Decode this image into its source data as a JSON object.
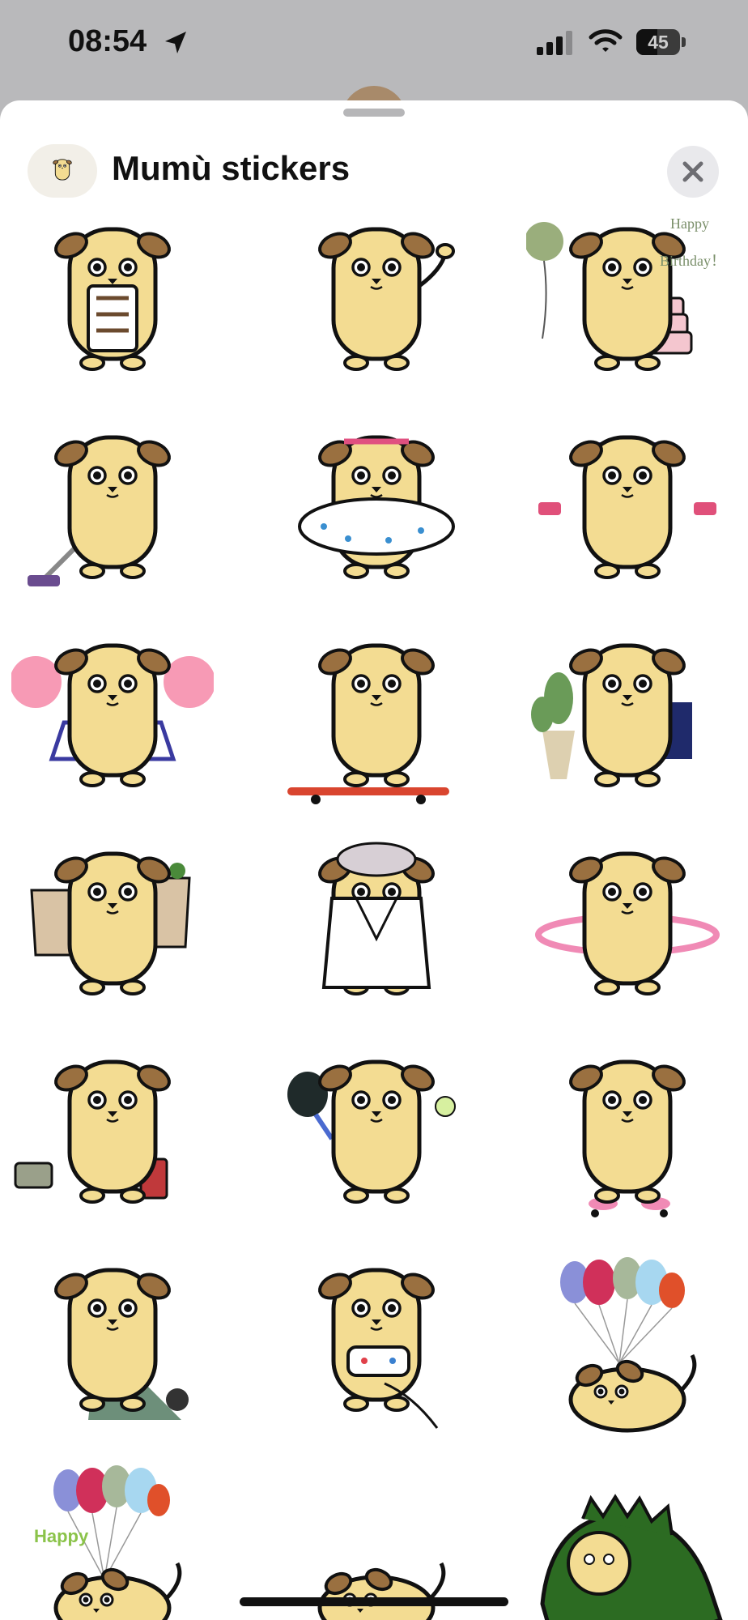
{
  "status_bar": {
    "time": "08:54",
    "battery": "45",
    "icons": [
      "location-arrow-icon",
      "cellular-signal-icon",
      "wifi-icon",
      "battery-icon"
    ]
  },
  "sheet": {
    "title": "Mumù stickers",
    "close_icon": "close-icon"
  },
  "stickers": [
    {
      "name": "sticker-mumu-coffee",
      "prop": "coffee",
      "texts": []
    },
    {
      "name": "sticker-mumu-waving",
      "prop": "wave",
      "texts": []
    },
    {
      "name": "sticker-mumu-birthday",
      "prop": "cake",
      "texts": [
        "Happy",
        "Birthday！"
      ]
    },
    {
      "name": "sticker-mumu-vacuum",
      "prop": "vacuum",
      "texts": []
    },
    {
      "name": "sticker-mumu-swim-ring",
      "prop": "swim",
      "texts": []
    },
    {
      "name": "sticker-mumu-dumbbells",
      "prop": "dumbbell",
      "texts": []
    },
    {
      "name": "sticker-mumu-cheerleader",
      "prop": "cheer",
      "texts": []
    },
    {
      "name": "sticker-mumu-skateboard",
      "prop": "skate",
      "texts": []
    },
    {
      "name": "sticker-mumu-gardening",
      "prop": "garden",
      "texts": []
    },
    {
      "name": "sticker-mumu-shopping",
      "prop": "shopping",
      "texts": []
    },
    {
      "name": "sticker-mumu-bathrobe",
      "prop": "bathrobe",
      "texts": []
    },
    {
      "name": "sticker-mumu-hula-hoop",
      "prop": "hoop",
      "texts": []
    },
    {
      "name": "sticker-mumu-travel",
      "prop": "travel",
      "texts": []
    },
    {
      "name": "sticker-mumu-padel",
      "prop": "padel",
      "texts": []
    },
    {
      "name": "sticker-mumu-roller-skates",
      "prop": "roller",
      "texts": []
    },
    {
      "name": "sticker-mumu-knitting",
      "prop": "knit",
      "texts": []
    },
    {
      "name": "sticker-mumu-gaming",
      "prop": "game",
      "texts": []
    },
    {
      "name": "sticker-mumu-balloons",
      "prop": "balloons",
      "texts": []
    },
    {
      "name": "sticker-mumu-happy-balloons",
      "prop": "balloons-lying",
      "texts": [
        "Happy"
      ]
    },
    {
      "name": "sticker-mumu-lying",
      "prop": "lying",
      "texts": []
    },
    {
      "name": "sticker-mumu-dinosaur",
      "prop": "dino",
      "texts": []
    }
  ],
  "colors": {
    "body": "#f3dc92",
    "ear": "#9a7040",
    "outline": "#111111",
    "sheet": "#ffffff",
    "backdrop": "#b9b9bb",
    "close_bg": "#e9e9ec",
    "happy_green": "#8bc34a",
    "birthday_text": "#7a8f6a"
  }
}
